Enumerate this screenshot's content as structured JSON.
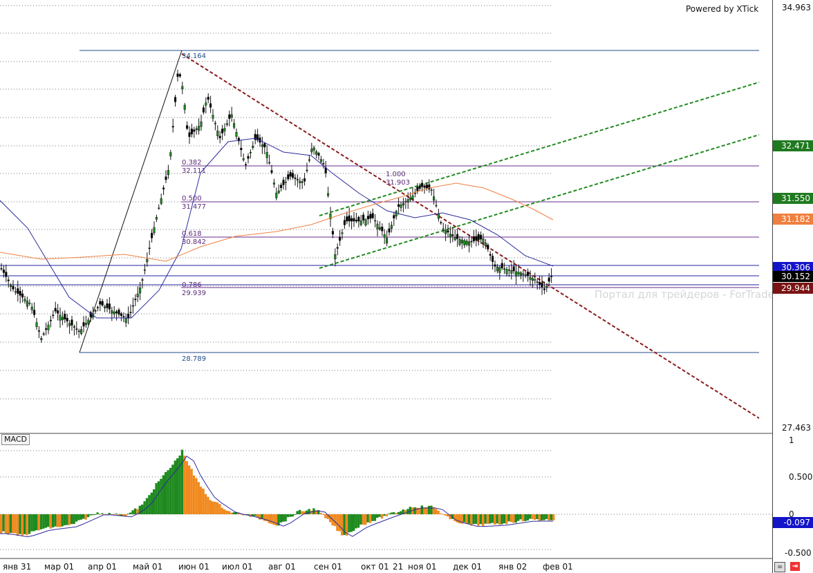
{
  "branding": {
    "powered_by": "Powered by XTick",
    "watermark": "Портал для трейдеров - ForTrader.ru"
  },
  "price_axis": {
    "labels": [
      "34.963",
      "27.463"
    ],
    "tags": [
      {
        "value": "32.471",
        "bg": "#1f7a1f",
        "fg": "#ffffff"
      },
      {
        "value": "31.550",
        "bg": "#1f7a1f",
        "fg": "#ffffff"
      },
      {
        "value": "31.182",
        "bg": "#f08040",
        "fg": "#ffffff"
      },
      {
        "value": "30.306",
        "bg": "#1414c8",
        "fg": "#ffffff"
      },
      {
        "value": "30.152",
        "bg": "#000000",
        "fg": "#ffffff"
      },
      {
        "value": "29.944",
        "bg": "#7a1414",
        "fg": "#ffffff"
      }
    ]
  },
  "macd_axis": {
    "title": "MACD",
    "labels": [
      "1",
      "0.500",
      "0",
      "-0.500"
    ],
    "tag": {
      "value": "-0.097",
      "bg": "#1414c8",
      "fg": "#ffffff"
    }
  },
  "date_axis": [
    "янв 31",
    "мар 01",
    "апр 01",
    "май 01",
    "июн 01",
    "июл 01",
    "авг 01",
    "сен 01",
    "окт 01",
    "21",
    "ноя 01",
    "дек 01",
    "янв 02",
    "фев 01"
  ],
  "levels": {
    "high": "34.164",
    "low": "28.789"
  },
  "fibonacci": [
    {
      "ratio": "0.382",
      "price": "32.111"
    },
    {
      "ratio": "0.500",
      "price": "31.477"
    },
    {
      "ratio": "0.618",
      "price": "30.842"
    },
    {
      "ratio": "0.786",
      "price": "29.939"
    },
    {
      "ratio": "1.000",
      "price": "31.903"
    }
  ],
  "colors": {
    "up": "#1f8a1f",
    "down": "#1f8a1f",
    "trend_red": "#8b1a1a",
    "channel_green": "#1f8a1f",
    "ma_blue": "#2a2aa0",
    "ma_orange": "#f08040",
    "macd_up": "#1f8a1f",
    "macd_down": "#f08a20"
  },
  "controls": {
    "settings_icon": "toggle-icon",
    "close_icon": "exit-icon"
  }
}
